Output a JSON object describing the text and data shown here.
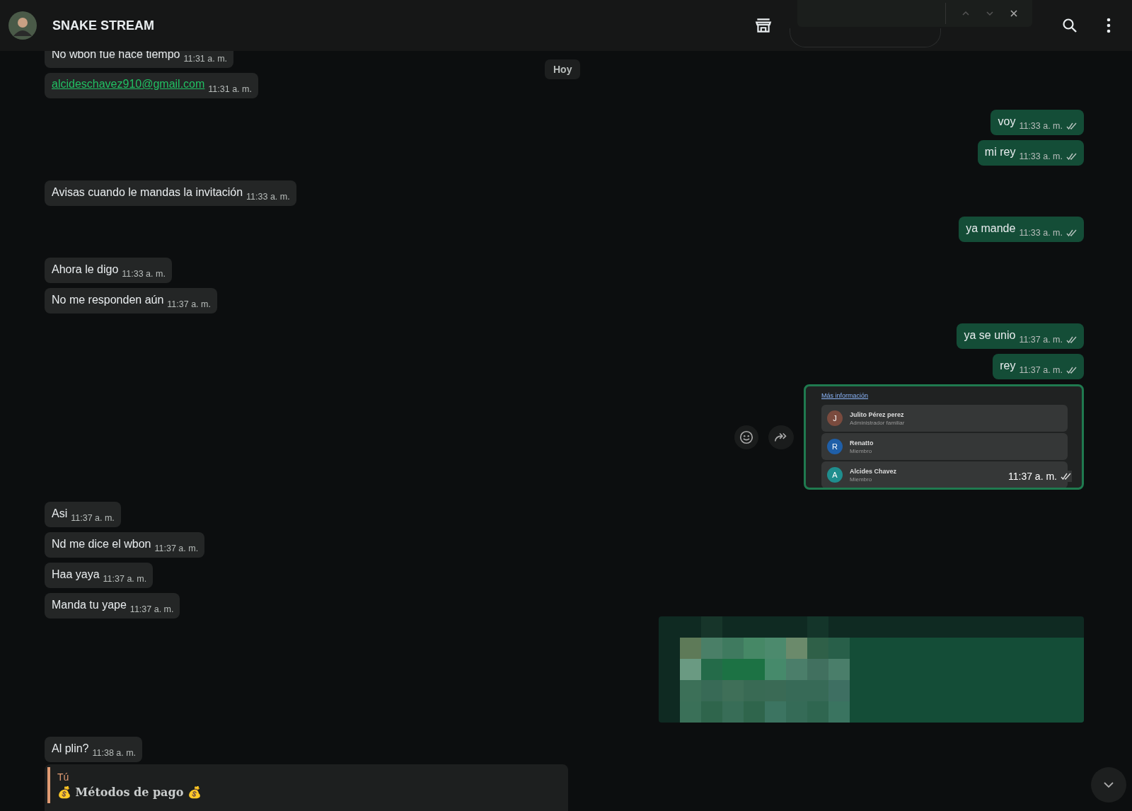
{
  "header": {
    "title": "SNAKE STREAM"
  },
  "date_chip": "Hoy",
  "incoming_groups": [
    [
      {
        "kind": "text",
        "text": "No wbon fue hace tiempo",
        "time": "11:31 a. m."
      },
      {
        "kind": "link",
        "text": "alcideschavez910@gmail.com",
        "time": "11:31 a. m."
      }
    ],
    [
      {
        "kind": "text",
        "text": "Avisas cuando le mandas la invitación",
        "time": "11:33 a. m."
      }
    ],
    [
      {
        "kind": "text",
        "text": "Ahora le digo",
        "time": "11:33 a. m."
      },
      {
        "kind": "text",
        "text": "No me responden aún",
        "time": "11:37 a. m."
      }
    ],
    [
      {
        "kind": "text",
        "text": "Asi",
        "time": "11:37 a. m."
      },
      {
        "kind": "text",
        "text": "Nd me dice el wbon",
        "time": "11:37 a. m."
      },
      {
        "kind": "text",
        "text": "Haa yaya",
        "time": "11:37 a. m."
      },
      {
        "kind": "text",
        "text": "Manda tu yape",
        "time": "11:37 a. m."
      }
    ],
    [
      {
        "kind": "text",
        "text": "Al plin?",
        "time": "11:38 a. m."
      }
    ]
  ],
  "reply_card": {
    "author": "Tú",
    "quoted": "💰 Métodos de pago 💰"
  },
  "outgoing_groups": [
    [
      {
        "kind": "text",
        "text": "voy",
        "time": "11:33 a. m."
      },
      {
        "kind": "text",
        "text": "mi rey",
        "time": "11:33 a. m."
      }
    ],
    [
      {
        "kind": "text",
        "text": "ya mande",
        "time": "11:33 a. m."
      }
    ],
    [
      {
        "kind": "text",
        "text": "ya se unio",
        "time": "11:37 a. m."
      },
      {
        "kind": "text",
        "text": "rey",
        "time": "11:37 a. m."
      },
      {
        "kind": "screenshot",
        "time": "11:37 a. m.",
        "link": "Más información",
        "members": [
          {
            "initial": "J",
            "name": "Julito Pérez perez",
            "role": "Administrador familiar",
            "color": "#7a4b3e"
          },
          {
            "initial": "R",
            "name": "Renatto",
            "role": "Miembro",
            "color": "#1f5fa8"
          },
          {
            "initial": "A",
            "name": "Alcides Chavez",
            "role": "Miembro",
            "color": "#1f8e8e"
          }
        ]
      }
    ],
    [
      {
        "kind": "blurred"
      }
    ]
  ]
}
